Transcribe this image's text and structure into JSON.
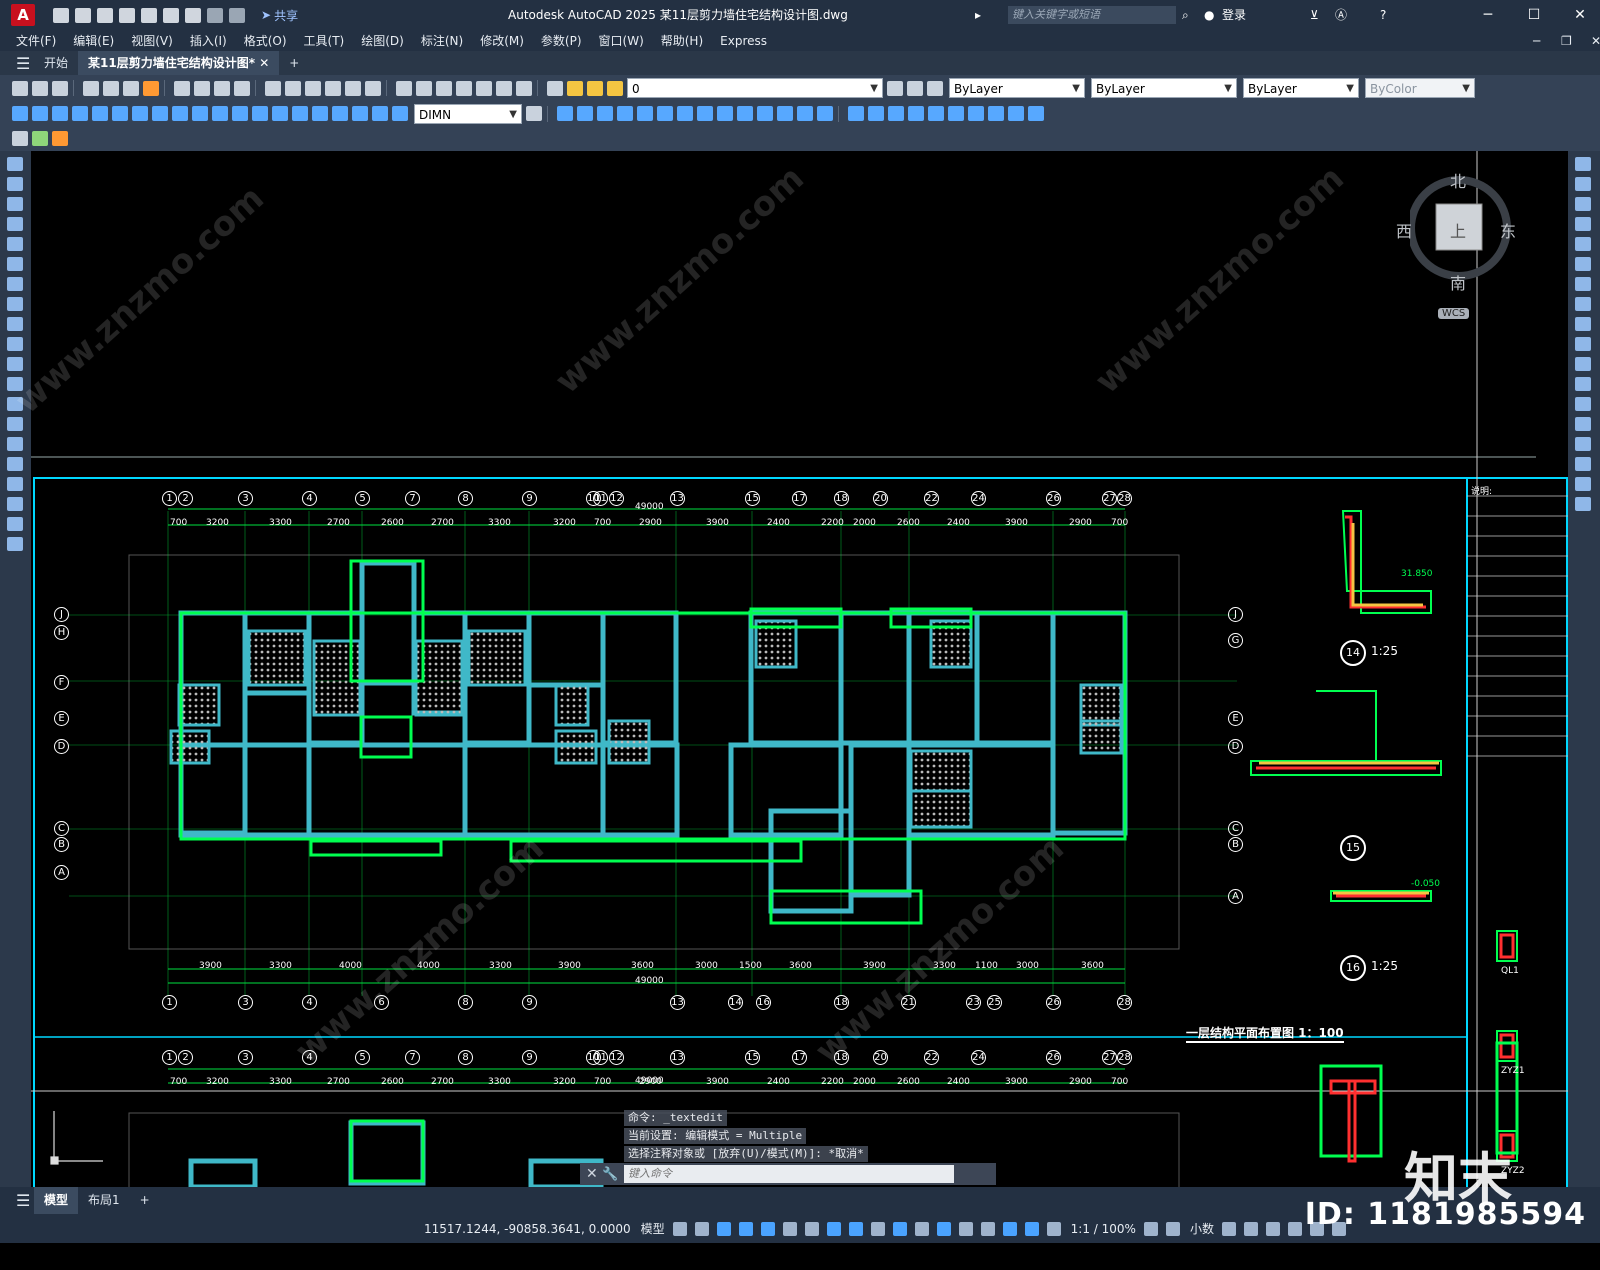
{
  "app": {
    "logo_letter": "A",
    "title": "Autodesk AutoCAD 2025    某11层剪力墙住宅结构设计图.dwg",
    "share_label": "共享",
    "search_placeholder": "键入关键字或短语",
    "login": "登录"
  },
  "window": {
    "minimize": "─",
    "maximize": "☐",
    "close": "✕"
  },
  "menu": [
    "文件(F)",
    "编辑(E)",
    "视图(V)",
    "插入(I)",
    "格式(O)",
    "工具(T)",
    "绘图(D)",
    "标注(N)",
    "修改(M)",
    "参数(P)",
    "窗口(W)",
    "帮助(H)",
    "Express"
  ],
  "doc_tabs": [
    {
      "label": "开始"
    },
    {
      "label": "某11层剪力墙住宅结构设计图*",
      "close": "✕"
    }
  ],
  "toolbars": {
    "layer_value": "0",
    "dim_style": "DIMN",
    "color": "ByLayer",
    "linetype": "ByLayer",
    "lineweight": "ByLayer",
    "plotstyle": "ByColor"
  },
  "viewcube": {
    "north": "北",
    "south": "南",
    "east": "东",
    "west": "西",
    "face": "上",
    "wcs": "WCS"
  },
  "drawing": {
    "title": "一层结构平面布置图 1：100",
    "total_dim": "49000",
    "top_dims": [
      "700",
      "3200",
      "3300",
      "2700",
      "2600",
      "2700",
      "3300",
      "3200",
      "700",
      "2900",
      "3900",
      "2400",
      "2200",
      "2000",
      "2600",
      "2400",
      "3900",
      "2900",
      "700"
    ],
    "bottom_dims": [
      "3900",
      "3300",
      "4000",
      "4000",
      "3300",
      "3900",
      "3600",
      "3000",
      "1500",
      "3600",
      "3900",
      "3300",
      "1100",
      "3000",
      "3600"
    ],
    "axis_top": [
      "1",
      "2",
      "3",
      "4",
      "5",
      "7",
      "8",
      "9",
      "10",
      "11",
      "12",
      "13",
      "15",
      "17",
      "18",
      "20",
      "22",
      "24",
      "26",
      "27",
      "28"
    ],
    "axis_bottom": [
      "1",
      "3",
      "4",
      "6",
      "8",
      "9",
      "13",
      "14",
      "16",
      "18",
      "21",
      "23",
      "25",
      "26",
      "28"
    ],
    "axis_left": [
      "J",
      "H",
      "F",
      "E",
      "D",
      "C",
      "B",
      "A"
    ],
    "axis_right": [
      "J",
      "G",
      "E",
      "D",
      "C",
      "B",
      "A"
    ],
    "details": [
      {
        "num": "14",
        "scale": "1:25"
      },
      {
        "num": "15",
        "scale": ""
      },
      {
        "num": "16",
        "scale": "1:25"
      }
    ],
    "notes_header": "说明:",
    "detail_labels": [
      "31.850",
      "-0.050",
      "QL1",
      "ZYZ1",
      "ZYZ2"
    ]
  },
  "command": {
    "lines": [
      "命令: _textedit",
      "当前设置: 编辑模式 = Multiple",
      "选择注释对象或 [放弃(U)/模式(M)]: *取消*"
    ],
    "placeholder": "键入命令"
  },
  "layout_tabs": [
    "模型",
    "布局1"
  ],
  "status": {
    "coords": "11517.1244, -90858.3641, 0.0000",
    "mode": "模型",
    "scale": "1:1 / 100%",
    "units": "小数"
  },
  "watermark": {
    "id": "ID: 1181985594",
    "brand": "知末",
    "site": "www.znzmo.com"
  }
}
